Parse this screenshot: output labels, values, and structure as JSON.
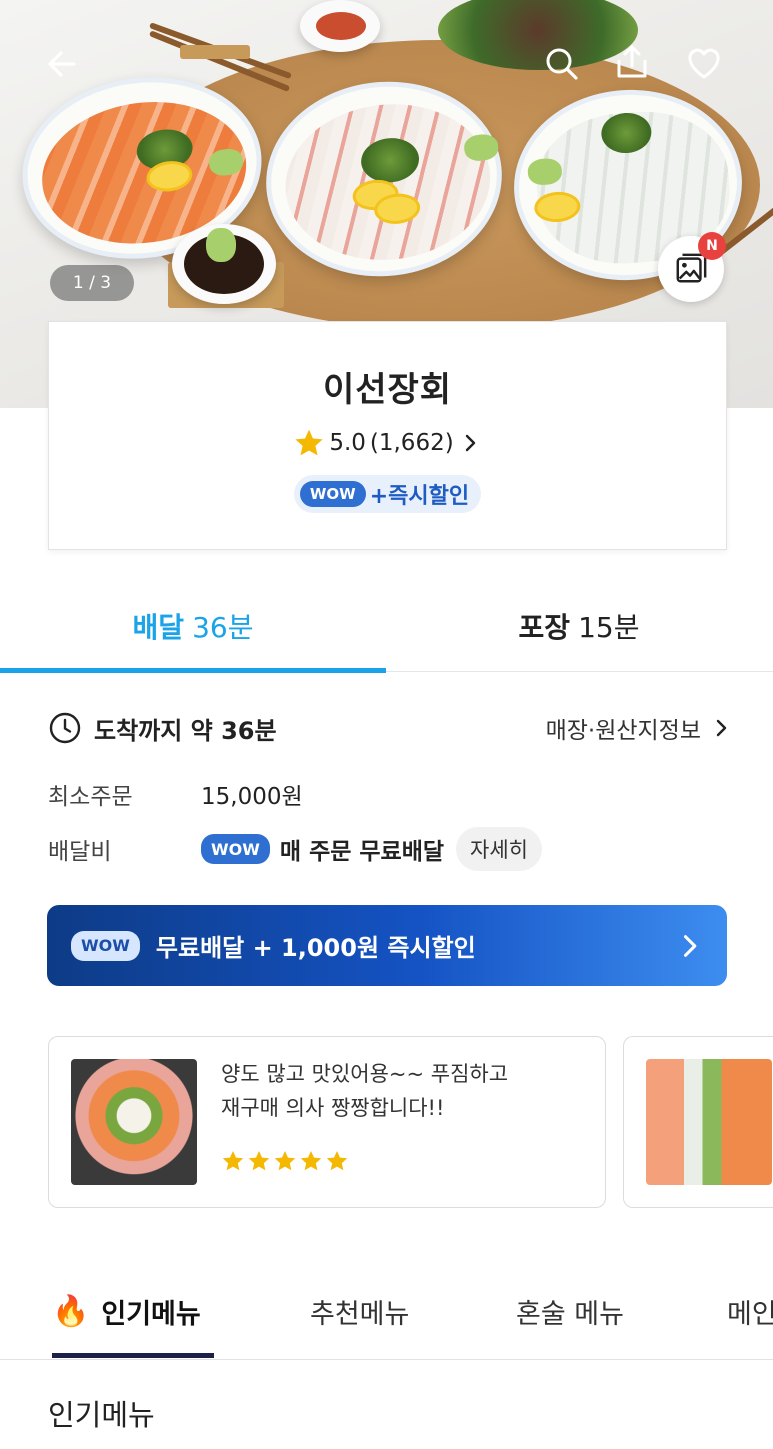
{
  "hero": {
    "photo_counter": "1 / 3",
    "new_badge": "N"
  },
  "store": {
    "name": "이선장회",
    "rating": "5.0",
    "review_count": "(1,662)",
    "wow_label": "WOW",
    "wow_benefit": "+즉시할인"
  },
  "delivery_tabs": [
    {
      "label": "배달",
      "time": "36분",
      "active": true
    },
    {
      "label": "포장",
      "time": "15분",
      "active": false
    }
  ],
  "arrival": {
    "text": "도착까지 약 36분",
    "store_info_link": "매장·원산지정보"
  },
  "min_order": {
    "label": "최소주문",
    "value": "15,000원"
  },
  "delivery_fee": {
    "label": "배달비",
    "wow_label": "WOW",
    "value": "매 주문 무료배달",
    "detail_button": "자세히"
  },
  "promo": {
    "wow_label": "WOW",
    "text": "무료배달 + 1,000원 즉시할인"
  },
  "reviews": [
    {
      "line1": "양도 많고 맛있어용~~ 푸짐하고",
      "line2": "재구매 의사 짱짱합니다!!",
      "stars": 5
    }
  ],
  "menu_tabs": [
    {
      "label": "인기메뉴",
      "icon": "fire-icon",
      "active": true
    },
    {
      "label": "추천메뉴",
      "active": false
    },
    {
      "label": "혼술 메뉴",
      "active": false
    },
    {
      "label": "메인",
      "active": false
    }
  ],
  "section_title": "인기메뉴",
  "colors": {
    "accent_blue": "#1aa3e8",
    "wow_blue": "#2f6fd1",
    "star_yellow": "#f5b800",
    "menu_underline": "#1b2148"
  }
}
